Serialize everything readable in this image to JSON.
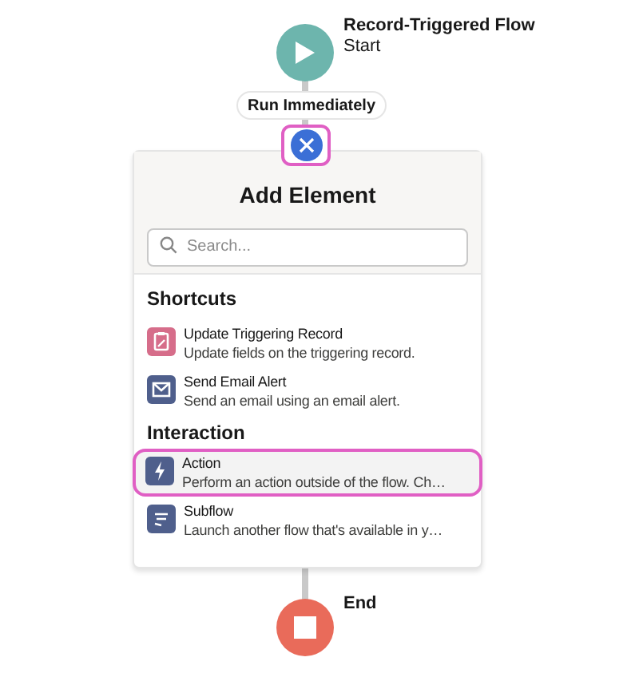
{
  "start": {
    "title": "Record-Triggered Flow",
    "subtitle": "Start"
  },
  "path_label": "Run Immediately",
  "panel": {
    "title": "Add Element",
    "search": {
      "placeholder": "Search..."
    },
    "sections": [
      {
        "heading": "Shortcuts",
        "items": [
          {
            "kind": "record",
            "title": "Update Triggering Record",
            "description": "Update fields on the triggering record.",
            "selected": false
          },
          {
            "kind": "email",
            "title": "Send Email Alert",
            "description": "Send an email using an email alert.",
            "selected": false
          }
        ]
      },
      {
        "heading": "Interaction",
        "items": [
          {
            "kind": "action",
            "title": "Action",
            "description": "Perform an action outside of the flow. Ch…",
            "selected": true
          },
          {
            "kind": "subflow",
            "title": "Subflow",
            "description": "Launch another flow that's available in y…",
            "selected": false
          }
        ]
      }
    ]
  },
  "end": {
    "title": "End"
  }
}
